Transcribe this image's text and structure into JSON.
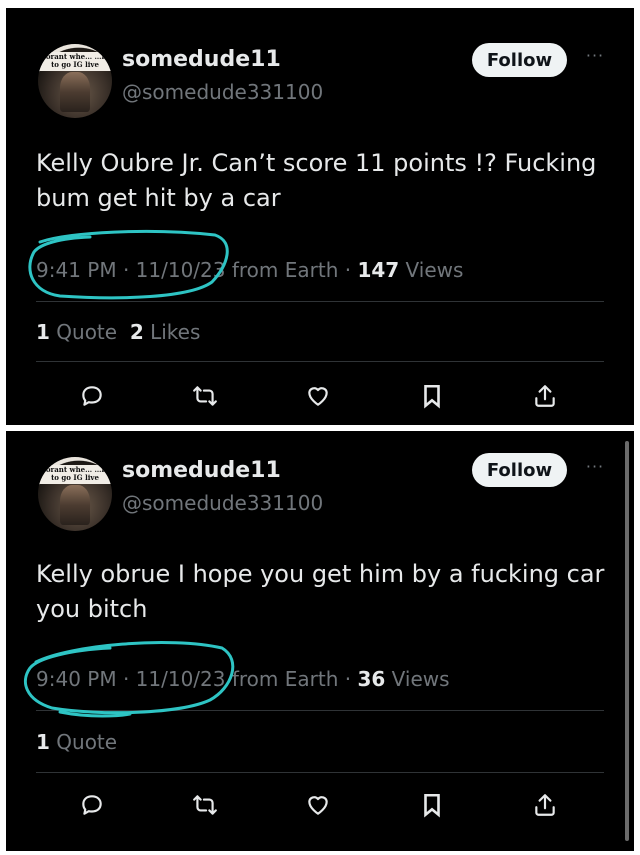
{
  "tweets": [
    {
      "avatar_caption": "…orant whe… …ne to go IG live",
      "username": "somedude11",
      "handle": "@somedude331100",
      "follow_label": "Follow",
      "more_label": "···",
      "text": "Kelly Oubre Jr. Can’t score 11 points !? Fucking bum get hit by a car",
      "time_date": "9:41 PM · 11/10/23",
      "location": " from Earth · ",
      "views_count": "147",
      "views_label": " Views",
      "quotes_count": "1",
      "quotes_label": " Quote",
      "likes_count": "2",
      "likes_label": " Likes"
    },
    {
      "avatar_caption": "…orant whe… …ne to go IG live",
      "username": "somedude11",
      "handle": "@somedude331100",
      "follow_label": "Follow",
      "more_label": "···",
      "text": "Kelly obrue I hope you get him by a fucking car you bitch",
      "time_date": "9:40 PM · 11/10/23",
      "location": " from Earth · ",
      "views_count": "36",
      "views_label": " Views",
      "quotes_count": "1",
      "quotes_label": " Quote"
    }
  ],
  "icons": [
    "reply-icon",
    "retweet-icon",
    "like-icon",
    "bookmark-icon",
    "share-icon"
  ],
  "colors": {
    "background": "#000000",
    "text": "#e7e9ea",
    "muted": "#71767b",
    "annotation": "#2ec4c4"
  }
}
